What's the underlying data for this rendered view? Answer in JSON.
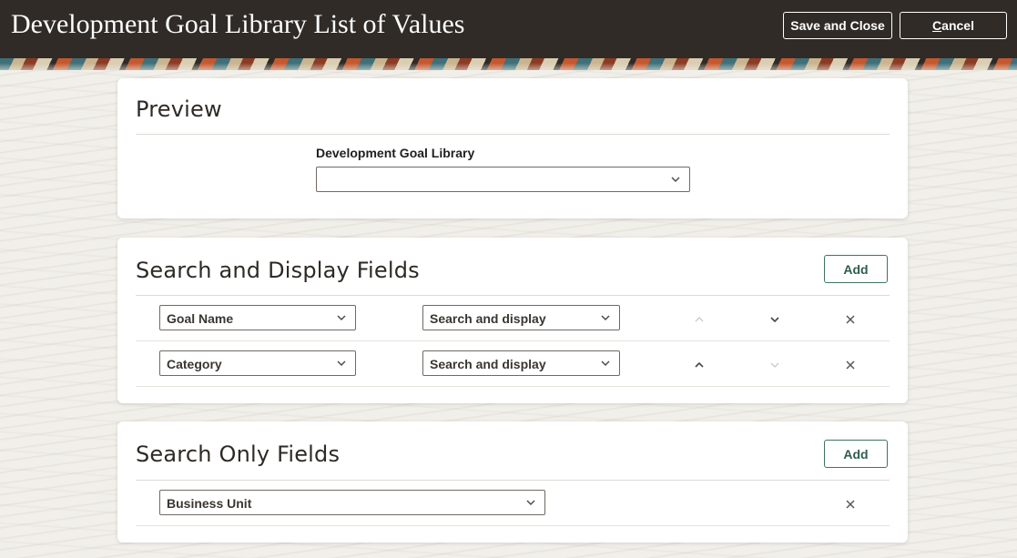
{
  "header": {
    "title": "Development Goal Library List of Values",
    "save_label": "Save and Close",
    "cancel_prefix": "",
    "cancel_underlined": "C",
    "cancel_rest": "ancel"
  },
  "preview": {
    "title": "Preview",
    "field_label": "Development Goal Library",
    "field_value": ""
  },
  "search_display": {
    "title": "Search and Display Fields",
    "add_label": "Add",
    "rows": [
      {
        "field": "Goal Name",
        "mode": "Search and display",
        "move_up_enabled": false,
        "move_down_enabled": true
      },
      {
        "field": "Category",
        "mode": "Search and display",
        "move_up_enabled": true,
        "move_down_enabled": false
      }
    ]
  },
  "search_only": {
    "title": "Search Only Fields",
    "add_label": "Add",
    "rows": [
      {
        "field": "Business Unit"
      }
    ]
  },
  "icons": {
    "dropdown": "chevron-down-icon",
    "move_up": "chevron-up-icon",
    "move_down": "chevron-down-icon",
    "remove": "close-icon"
  },
  "colors": {
    "header_bg": "#302b27",
    "accent_green": "#3f7362",
    "page_bg": "#f1efea"
  }
}
